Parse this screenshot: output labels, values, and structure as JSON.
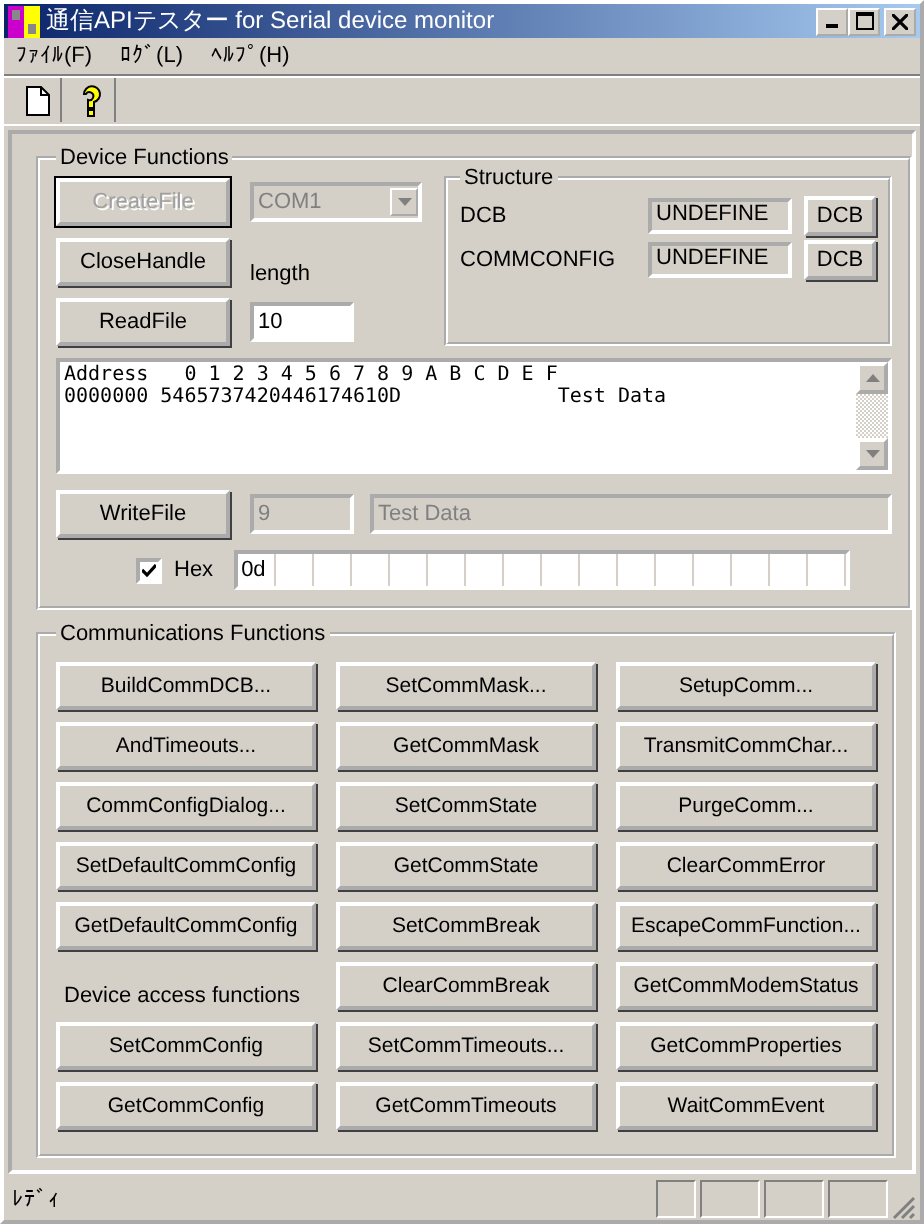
{
  "window": {
    "title": "通信APIテスター for Serial device monitor"
  },
  "menu": [
    "ﾌｧｲﾙ(F)",
    "ﾛｸﾞ(L)",
    "ﾍﾙﾌﾟ(H)"
  ],
  "toolbar": [
    {
      "kind": "new"
    },
    {
      "kind": "help"
    }
  ],
  "device_functions": {
    "title": "Device Functions",
    "create_file": {
      "label": "CreateFile",
      "disabled": true
    },
    "port": {
      "value": "COM1",
      "disabled": true
    },
    "close_handle": {
      "label": "CloseHandle",
      "disabled": false
    },
    "length": {
      "label": "length",
      "value": "10"
    },
    "read_file": {
      "label": "ReadFile",
      "disabled": false
    },
    "structure": {
      "title": "Structure",
      "rows": [
        {
          "label": "DCB",
          "value": "UNDEFINE",
          "button": "DCB"
        },
        {
          "label": "COMMCONFIG",
          "value": "UNDEFINE",
          "button": "DCB"
        }
      ]
    },
    "dump": [
      "Address   0 1 2 3 4 5 6 7 8 9 A B C D E F",
      "0000000 5465737420446174610D             Test Data"
    ],
    "write_file": {
      "label": "WriteFile",
      "disabled": false
    },
    "write_length": {
      "value": "9",
      "disabled": true
    },
    "write_text": {
      "value": "Test Data",
      "disabled": true
    },
    "hex": {
      "label": "Hex",
      "checked": true
    },
    "hex_bytes": [
      "0d"
    ]
  },
  "communications": {
    "title": "Communications Functions",
    "items": [
      {
        "kind": "button",
        "label": "BuildCommDCB..."
      },
      {
        "kind": "button",
        "label": "SetCommMask..."
      },
      {
        "kind": "button",
        "label": "SetupComm..."
      },
      {
        "kind": "button",
        "label": "AndTimeouts..."
      },
      {
        "kind": "button",
        "label": "GetCommMask"
      },
      {
        "kind": "button",
        "label": "TransmitCommChar..."
      },
      {
        "kind": "button",
        "label": "CommConfigDialog..."
      },
      {
        "kind": "button",
        "label": "SetCommState"
      },
      {
        "kind": "button",
        "label": "PurgeComm..."
      },
      {
        "kind": "button",
        "label": "SetDefaultCommConfig"
      },
      {
        "kind": "button",
        "label": "GetCommState"
      },
      {
        "kind": "button",
        "label": "ClearCommError"
      },
      {
        "kind": "button",
        "label": "GetDefaultCommConfig"
      },
      {
        "kind": "button",
        "label": "SetCommBreak"
      },
      {
        "kind": "button",
        "label": "EscapeCommFunction..."
      },
      {
        "kind": "label",
        "label": "Device access functions"
      },
      {
        "kind": "button",
        "label": "ClearCommBreak"
      },
      {
        "kind": "button",
        "label": "GetCommModemStatus"
      },
      {
        "kind": "button",
        "label": "SetCommConfig"
      },
      {
        "kind": "button",
        "label": "SetCommTimeouts..."
      },
      {
        "kind": "button",
        "label": "GetCommProperties"
      },
      {
        "kind": "button",
        "label": "GetCommConfig"
      },
      {
        "kind": "button",
        "label": "GetCommTimeouts"
      },
      {
        "kind": "button",
        "label": "WaitCommEvent"
      }
    ]
  },
  "status_bar": {
    "text": "ﾚﾃﾞｨ"
  }
}
